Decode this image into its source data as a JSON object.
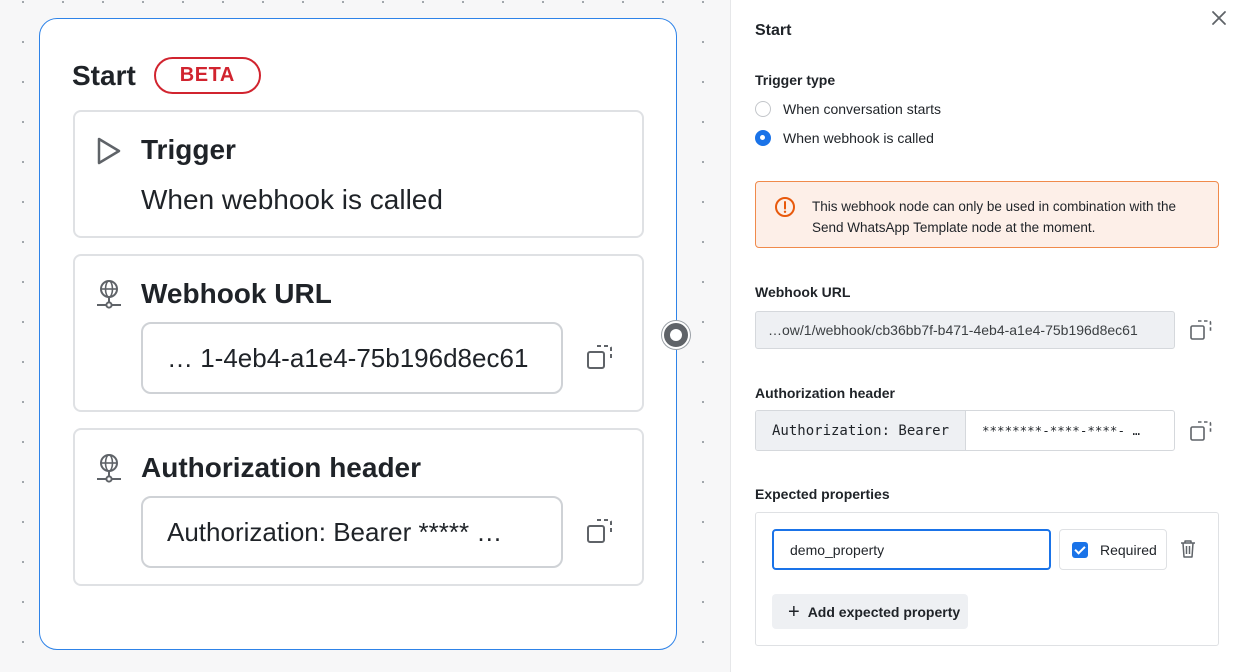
{
  "node": {
    "title": "Start",
    "badge": "BETA",
    "trigger": {
      "title": "Trigger",
      "value": "When webhook is called",
      "icon": "play-icon"
    },
    "webhook": {
      "title": "Webhook URL",
      "value": "…  1-4eb4-a1e4-75b196d8ec61",
      "icon": "globe-network-icon"
    },
    "auth": {
      "title": "Authorization header",
      "value": "Authorization: Bearer *****  …",
      "icon": "globe-network-icon"
    }
  },
  "panel": {
    "title": "Start",
    "trigger_type_label": "Trigger type",
    "trigger_options": [
      {
        "label": "When conversation starts",
        "selected": false
      },
      {
        "label": "When webhook is called",
        "selected": true
      }
    ],
    "alert": {
      "icon": "warning-circle-icon",
      "text": "This webhook node can only be used in combination with the Send WhatsApp Template node at the moment."
    },
    "webhook_url_label": "Webhook URL",
    "webhook_url_value": "…ow/1/webhook/cb36bb7f-b471-4eb4-a1e4-75b196d8ec61",
    "auth_header_label": "Authorization header",
    "auth_prefix": "Authorization: Bearer",
    "auth_value": "********-****-****- …",
    "expected_properties_label": "Expected properties",
    "property": {
      "name": "demo_property",
      "required_label": "Required",
      "required": true
    },
    "add_property_label": "Add expected property"
  },
  "colors": {
    "accent": "#1a73e8",
    "beta": "#d1242f",
    "alert_border": "#f08a4b",
    "alert_bg": "#fdefe8"
  }
}
